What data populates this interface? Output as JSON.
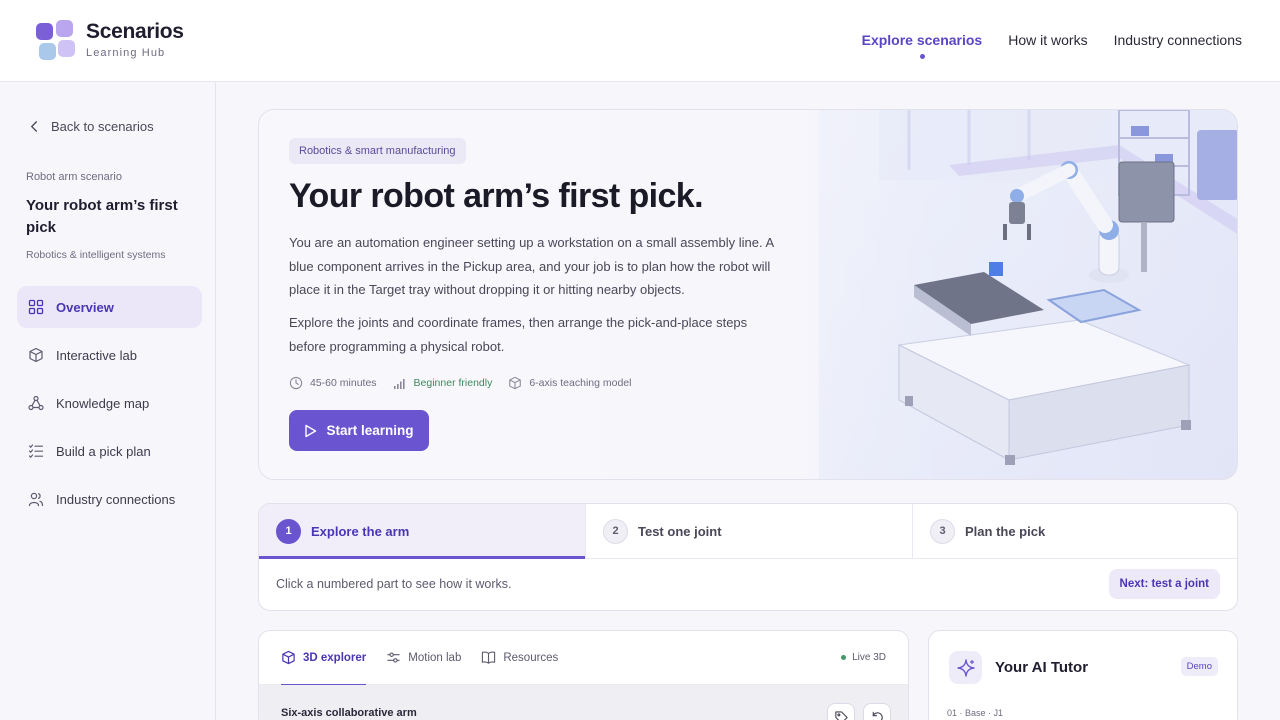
{
  "brand": {
    "name": "Scenarios",
    "sub": "Learning Hub"
  },
  "nav": {
    "items": [
      {
        "label": "Explore scenarios",
        "active": true
      },
      {
        "label": "How it works"
      },
      {
        "label": "Industry connections"
      }
    ]
  },
  "sidebar": {
    "back_label": "Back to scenarios",
    "eyebrow": "Robot arm scenario",
    "title": "Your robot arm’s first pick",
    "subtitle": "Robotics & intelligent systems",
    "items": [
      {
        "label": "Overview",
        "icon": "grid-icon",
        "active": true
      },
      {
        "label": "Interactive lab",
        "icon": "cube-icon"
      },
      {
        "label": "Knowledge map",
        "icon": "network-icon"
      },
      {
        "label": "Build a pick plan",
        "icon": "checklist-icon"
      },
      {
        "label": "Industry connections",
        "icon": "people-icon"
      }
    ]
  },
  "hero": {
    "chip": "Robotics & smart manufacturing",
    "title": "Your robot arm’s first pick.",
    "paragraph1": "You are an automation engineer setting up a workstation on a small assembly line. A blue component arrives in the Pickup area, and your job is to plan how the robot will place it in the Target tray without dropping it or hitting nearby objects.",
    "paragraph2": "Explore the joints and coordinate frames, then arrange the pick-and-place steps before programming a physical robot.",
    "meta": {
      "duration": "45-60 minutes",
      "level": "Beginner friendly",
      "model": "6-axis teaching model"
    },
    "start_label": "Start learning"
  },
  "steps": {
    "items": [
      {
        "number": "1",
        "label": "Explore the arm",
        "active": true
      },
      {
        "number": "2",
        "label": "Test one joint"
      },
      {
        "number": "3",
        "label": "Plan the pick"
      }
    ],
    "hint": "Click a numbered part to see how it works.",
    "next_label": "Next: test a joint"
  },
  "explorer": {
    "tabs": [
      {
        "label": "3D explorer",
        "icon": "cube-icon",
        "active": true
      },
      {
        "label": "Motion lab",
        "icon": "sliders-icon"
      },
      {
        "label": "Resources",
        "icon": "book-icon"
      }
    ],
    "live_label": "Live 3D",
    "title": "Six-axis collaborative arm"
  },
  "tutor": {
    "title": "Your AI Tutor",
    "badge": "Demo",
    "meta": "01 · Base · J1"
  },
  "colors": {
    "accent": "#6a54cf",
    "accent_text": "#4a36b4",
    "success": "#3f8a5e"
  }
}
